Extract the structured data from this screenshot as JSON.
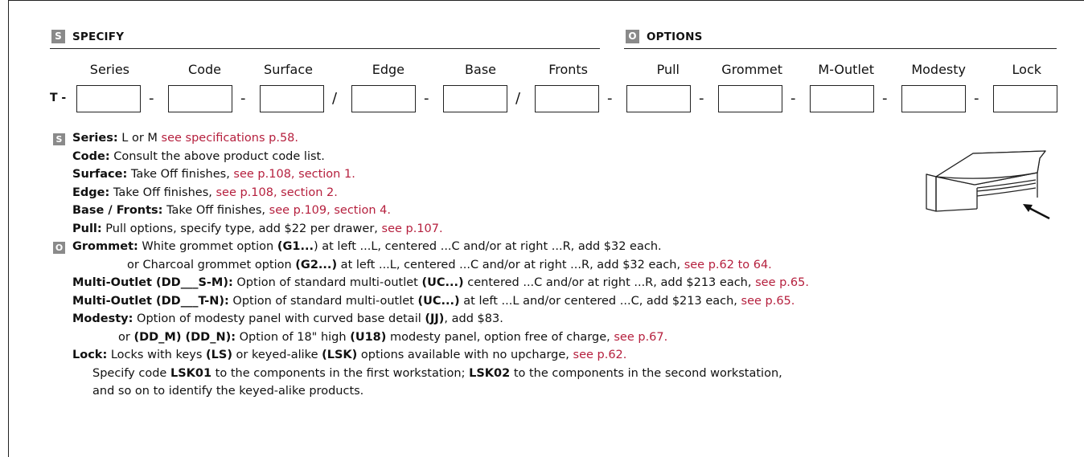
{
  "specify": {
    "badge": "S",
    "title": "SPECIFY"
  },
  "options": {
    "badge": "O",
    "title": "OPTIONS"
  },
  "code_prefix": "T -",
  "fields": [
    "Series",
    "Code",
    "Surface",
    "Edge",
    "Base",
    "Fronts",
    "Pull",
    "Grommet",
    "M-Outlet",
    "Modesty",
    "Lock"
  ],
  "separators": [
    "-",
    "-",
    "/",
    "-",
    "/",
    "-",
    "-",
    "-",
    "-",
    "-"
  ],
  "notes": {
    "s_badge": "S",
    "o_badge": "O",
    "series": {
      "label": "Series:",
      "text": " L or M ",
      "link": "see specifications p.58."
    },
    "code": {
      "label": "Code:",
      "text": " Consult the above product code list."
    },
    "surface": {
      "label": "Surface:",
      "text": " Take Off finishes, ",
      "link": "see p.108, section 1."
    },
    "edge": {
      "label": "Edge:",
      "text": " Take Off finishes, ",
      "link": "see p.108, section 2."
    },
    "base_fronts": {
      "label": "Base / Fronts:",
      "text": " Take Off finishes, ",
      "link": "see p.109, section 4."
    },
    "pull": {
      "label": "Pull:",
      "text": " Pull options, specify type, add $22 per drawer, ",
      "link": "see p.107."
    },
    "grommet": {
      "label": "Grommet:",
      "t1": " White grommet option ",
      "code1": "(G1...",
      "t2": ") at left ...L, centered ...C and/or at right ...R, add $32 each."
    },
    "grommet2": {
      "t1": "or Charcoal grommet option ",
      "code1": "(G2...)",
      "t2": " at left ...L, centered ...C and/or at right ...R, add $32 each, ",
      "link": "see p.62 to 64."
    },
    "mo1": {
      "label": "Multi-Outlet (DD___S-M):",
      "t1": " Option of standard multi-outlet ",
      "code1": "(UC...)",
      "t2": " centered ...C and/or at right ...R, add $213 each, ",
      "link": "see p.65."
    },
    "mo2": {
      "label": "Multi-Outlet (DD___T-N):",
      "t1": " Option of standard multi-outlet ",
      "code1": "(UC...)",
      "t2": " at left ...L and/or centered ...C, add $213 each, ",
      "link": "see p.65."
    },
    "modesty": {
      "label": "Modesty:",
      "t1": " Option of modesty panel with curved base detail ",
      "code1": "(JJ)",
      "t2": ", add $83."
    },
    "modesty2": {
      "t1": "or ",
      "code1": "(DD_M) (DD_N):",
      "t2": " Option of 18\" high ",
      "code2": "(U18)",
      "t3": " modesty panel, option free of charge, ",
      "link": "see p.67."
    },
    "lock": {
      "label": "Lock:",
      "t1": " Locks with keys ",
      "code1": "(LS)",
      "t2": " or keyed-alike ",
      "code2": "(LSK)",
      "t3": " options available with no upcharge, ",
      "link": "see p.62."
    },
    "lock2": {
      "t1": "Specify code ",
      "code1": "LSK01",
      "t2": " to the components in the first workstation; ",
      "code2": "LSK02",
      "t3": " to the components in the second workstation,"
    },
    "lock3": {
      "t1": "and so on to identify the keyed-alike products."
    }
  }
}
